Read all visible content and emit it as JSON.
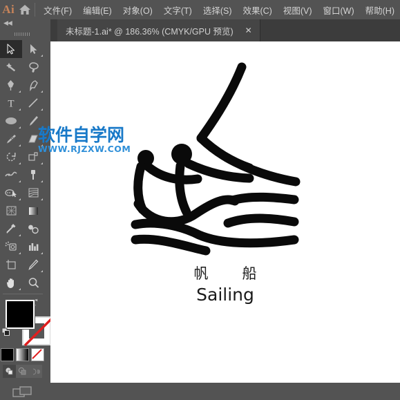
{
  "app": {
    "logo_text": "Ai",
    "logo_color": "#c8845a",
    "home_icon": "home-icon"
  },
  "menubar": {
    "items": [
      {
        "label": "文件(F)",
        "name": "menu-file"
      },
      {
        "label": "编辑(E)",
        "name": "menu-edit"
      },
      {
        "label": "对象(O)",
        "name": "menu-object"
      },
      {
        "label": "文字(T)",
        "name": "menu-type"
      },
      {
        "label": "选择(S)",
        "name": "menu-select"
      },
      {
        "label": "效果(C)",
        "name": "menu-effect"
      },
      {
        "label": "视图(V)",
        "name": "menu-view"
      },
      {
        "label": "窗口(W)",
        "name": "menu-window"
      },
      {
        "label": "帮助(H)",
        "name": "menu-help"
      }
    ]
  },
  "tabbar": {
    "document_tab": {
      "title": "未标题-1.ai* @ 186.36% (CMYK/GPU 预览)",
      "close_glyph": "✕",
      "file_name": "未标题-1.ai",
      "modified": true,
      "zoom": "186.36%",
      "color_mode": "CMYK",
      "render_mode": "GPU 预览"
    }
  },
  "toolpanel": {
    "collapse_glyph": "◀◀",
    "tools": [
      {
        "name": "selection-tool",
        "label": "选择工具",
        "selected": true,
        "has_flyout": false
      },
      {
        "name": "direct-selection-tool",
        "label": "直接选择工具",
        "selected": false,
        "has_flyout": true
      },
      {
        "name": "magic-wand-tool",
        "label": "魔棒工具",
        "selected": false,
        "has_flyout": false
      },
      {
        "name": "lasso-tool",
        "label": "套索工具",
        "selected": false,
        "has_flyout": false
      },
      {
        "name": "pen-tool",
        "label": "钢笔工具",
        "selected": false,
        "has_flyout": true
      },
      {
        "name": "curvature-tool",
        "label": "曲率工具",
        "selected": false,
        "has_flyout": false
      },
      {
        "name": "type-tool",
        "label": "文字工具",
        "selected": false,
        "has_flyout": true
      },
      {
        "name": "line-segment-tool",
        "label": "直线段工具",
        "selected": false,
        "has_flyout": true
      },
      {
        "name": "ellipse-tool",
        "label": "椭圆工具",
        "selected": false,
        "has_flyout": true
      },
      {
        "name": "paintbrush-tool",
        "label": "画笔工具",
        "selected": false,
        "has_flyout": true
      },
      {
        "name": "shaper-tool",
        "label": "Shaper 工具",
        "selected": false,
        "has_flyout": true
      },
      {
        "name": "eraser-tool",
        "label": "橡皮擦工具",
        "selected": false,
        "has_flyout": true
      },
      {
        "name": "rotate-tool",
        "label": "旋转工具",
        "selected": false,
        "has_flyout": true
      },
      {
        "name": "scale-tool",
        "label": "比例缩放工具",
        "selected": false,
        "has_flyout": true
      },
      {
        "name": "width-tool",
        "label": "宽度工具",
        "selected": false,
        "has_flyout": true
      },
      {
        "name": "free-transform-tool",
        "label": "自由变换工具",
        "selected": false,
        "has_flyout": true
      },
      {
        "name": "shape-builder-tool",
        "label": "形状生成器工具",
        "selected": false,
        "has_flyout": true
      },
      {
        "name": "perspective-grid-tool",
        "label": "透视网格工具",
        "selected": false,
        "has_flyout": true
      },
      {
        "name": "mesh-tool",
        "label": "网格工具",
        "selected": false,
        "has_flyout": false
      },
      {
        "name": "gradient-tool",
        "label": "渐变工具",
        "selected": false,
        "has_flyout": false
      },
      {
        "name": "eyedropper-tool",
        "label": "吸管工具",
        "selected": false,
        "has_flyout": true
      },
      {
        "name": "blend-tool",
        "label": "混合工具",
        "selected": false,
        "has_flyout": false
      },
      {
        "name": "symbol-sprayer-tool",
        "label": "符号喷枪工具",
        "selected": false,
        "has_flyout": true
      },
      {
        "name": "column-graph-tool",
        "label": "柱形图工具",
        "selected": false,
        "has_flyout": true
      },
      {
        "name": "artboard-tool",
        "label": "画板工具",
        "selected": false,
        "has_flyout": false
      },
      {
        "name": "slice-tool",
        "label": "切片工具",
        "selected": false,
        "has_flyout": true
      },
      {
        "name": "hand-tool",
        "label": "抓手工具",
        "selected": false,
        "has_flyout": true
      },
      {
        "name": "zoom-tool",
        "label": "缩放工具",
        "selected": false,
        "has_flyout": false
      }
    ],
    "fill_stroke": {
      "fill_color": "#000000",
      "stroke_color": "none",
      "swap_label": "互换填色和描边",
      "default_label": "默认填色和描边"
    },
    "color_modes": [
      {
        "name": "color-mode-flat",
        "label": "颜色",
        "selected": true
      },
      {
        "name": "color-mode-gradient",
        "label": "渐变",
        "selected": false
      },
      {
        "name": "color-mode-none",
        "label": "无",
        "selected": false
      }
    ],
    "draw_modes": [
      {
        "name": "draw-normal-mode",
        "label": "正常绘图",
        "selected": true
      },
      {
        "name": "draw-behind-mode",
        "label": "背面绘图",
        "selected": false
      },
      {
        "name": "draw-inside-mode",
        "label": "内部绘图",
        "selected": false
      }
    ],
    "screen_mode": {
      "name": "change-screen-mode",
      "label": "更改屏幕模式"
    }
  },
  "canvas": {
    "artwork": {
      "name": "sailing-boat-illustration",
      "description": "黑色线条风格的帆船与两名船员图标",
      "stroke_color": "#000000"
    },
    "caption": {
      "chinese": "帆　船",
      "english": "Sailing"
    },
    "watermark": {
      "chinese": "软件自学网",
      "url": "WWW.RJZXW.COM",
      "color": "#1879c8"
    }
  }
}
